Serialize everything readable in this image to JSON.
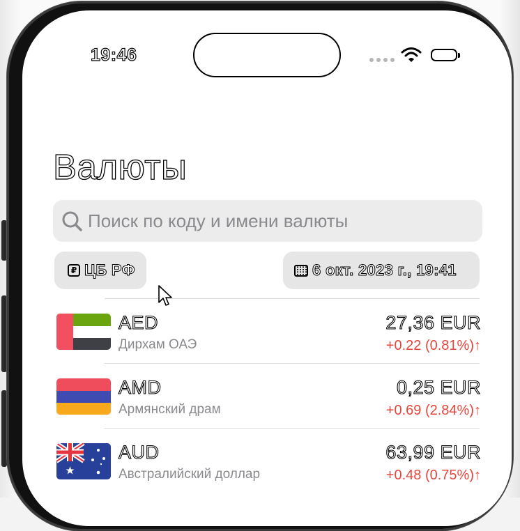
{
  "status_bar": {
    "time": "19:46"
  },
  "header": {
    "title": "Валюты"
  },
  "search": {
    "placeholder": "Поиск по коду и имени валюты"
  },
  "filters": {
    "source_label": "ЦБ РФ",
    "source_icon": "ruble-icon",
    "date_label": "6 окт. 2023 г., 19:41",
    "date_icon": "calendar-icon"
  },
  "currencies": [
    {
      "code": "AED",
      "name": "Дирхам ОАЭ",
      "price": "27,36 EUR",
      "change": "+0.22 (0.81%)↑",
      "flag": "uae-flag"
    },
    {
      "code": "AMD",
      "name": "Армянский драм",
      "price": "0,25 EUR",
      "change": "+0.69 (2.84%)↑",
      "flag": "armenia-flag"
    },
    {
      "code": "AUD",
      "name": "Австралийский доллар",
      "price": "63,99 EUR",
      "change": "+0.48 (0.75%)↑",
      "flag": "australia-flag"
    }
  ],
  "colors": {
    "positive_change": "#e5453b",
    "secondary_text": "#8a8a8e",
    "chip_bg": "#e6e6e6"
  }
}
